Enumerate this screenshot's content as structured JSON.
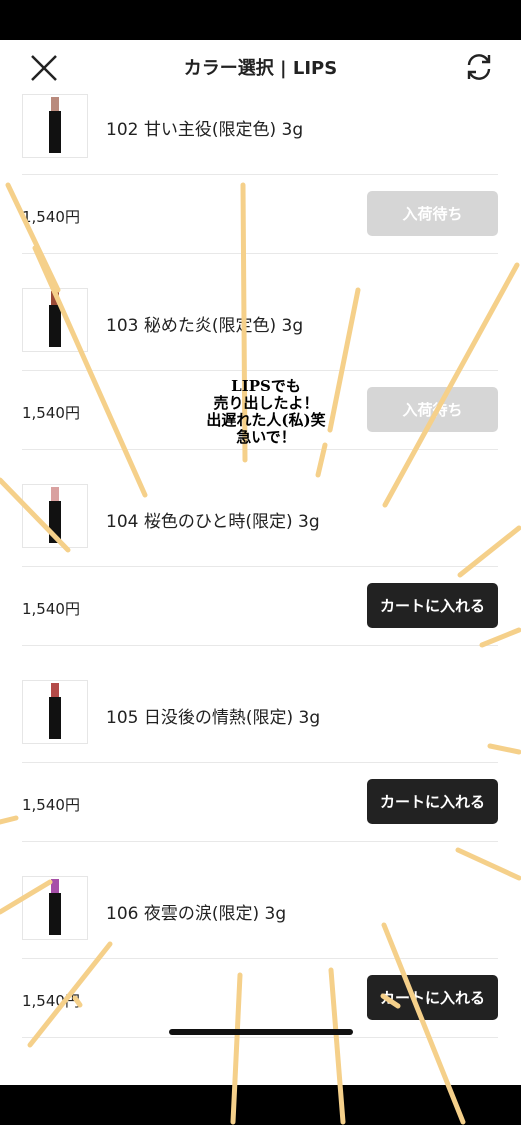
{
  "header": {
    "title": "カラー選択 | LIPS"
  },
  "items": [
    {
      "name": "102 甘い主役(限定色) 3g",
      "price": "1,540円",
      "button": "入荷待ち",
      "lip_color": "#b98a7c"
    },
    {
      "name": "103 秘めた炎(限定色) 3g",
      "price": "1,540円",
      "button": "入荷待ち",
      "lip_color": "#9a4a36"
    },
    {
      "name": "104 桜色のひと時(限定) 3g",
      "price": "1,540円",
      "button": "カートに入れる",
      "lip_color": "#d9a1a0"
    },
    {
      "name": "105 日没後の情熱(限定) 3g",
      "price": "1,540円",
      "button": "カートに入れる",
      "lip_color": "#b34a48"
    },
    {
      "name": "106 夜雲の涙(限定) 3g",
      "price": "1,540円",
      "button": "カートに入れる",
      "lip_color": "#a64fa8"
    }
  ],
  "overlay": {
    "lines": [
      "LIPSでも",
      "売り出したよ！",
      "出遅れた人(私)笑",
      "急いで！"
    ]
  },
  "colors": {
    "ray": "#f5d08a",
    "button_active": "#222222",
    "button_disabled": "#d6d6d6"
  },
  "icons": {
    "close": "close-icon",
    "refresh": "refresh-icon"
  }
}
